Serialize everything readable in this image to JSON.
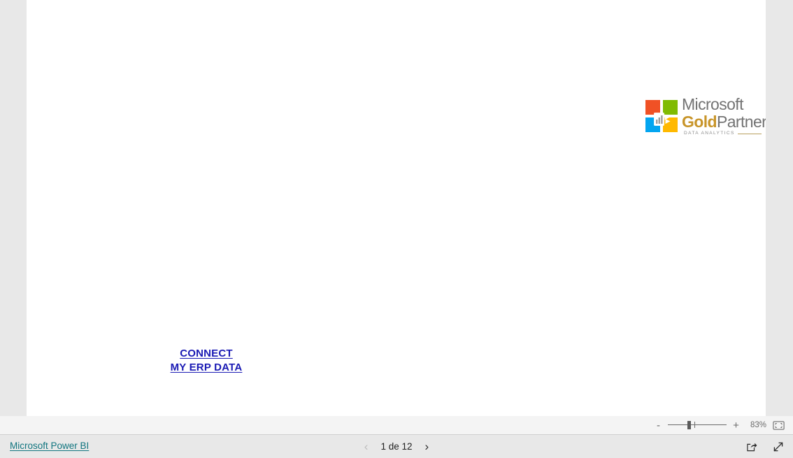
{
  "report": {
    "links": [
      {
        "label": "CONNECT",
        "name": "connect-link"
      },
      {
        "label": "MY ERP DATA",
        "name": "my-erp-data-link"
      }
    ],
    "partner_logo": {
      "brand": "Microsoft",
      "gold": "Gold",
      "partner": "Partner",
      "tagline": "DATA ANALYTICS",
      "colors": {
        "square_red": "#f05125",
        "square_green": "#80bb03",
        "square_blue": "#03a5f0",
        "square_yellow": "#ffb900",
        "gold_text": "#c8952a",
        "gray_text": "#737373"
      }
    }
  },
  "zoom_bar": {
    "minus_label": "-",
    "plus_label": "+",
    "percent": "83%",
    "fit_icon": "fit-to-page-icon"
  },
  "footer": {
    "brand": "Microsoft Power BI",
    "page_label": "1 de 12",
    "prev_icon": "chevron-left-icon",
    "next_icon": "chevron-right-icon",
    "share_icon": "share-icon",
    "fullscreen_icon": "fullscreen-icon",
    "link_color": "#11757f"
  }
}
